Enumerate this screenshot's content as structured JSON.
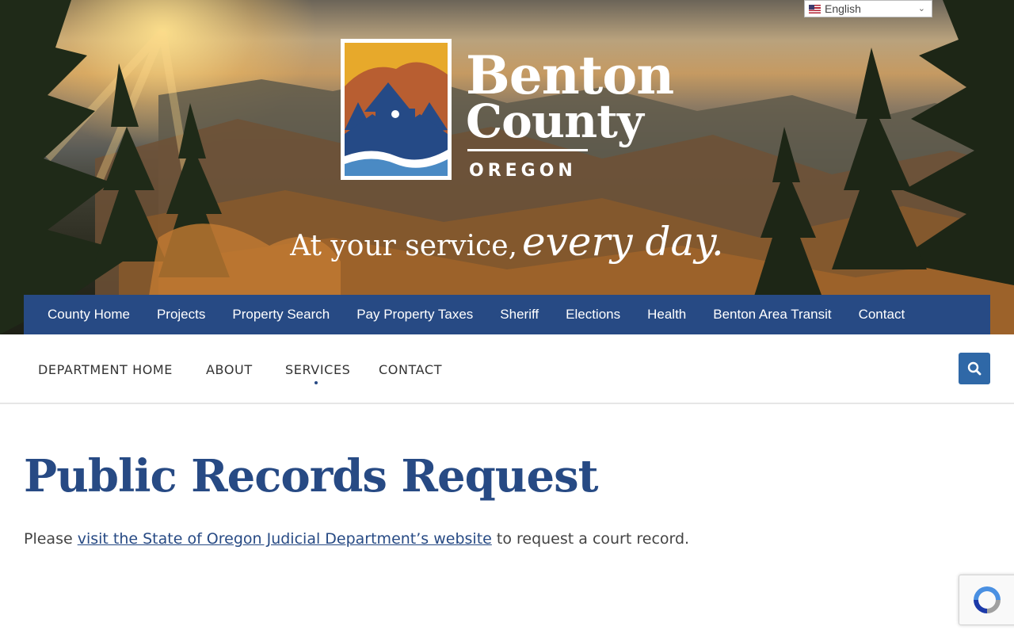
{
  "language_selector": {
    "label": "English"
  },
  "logo": {
    "word1": "Benton",
    "word2": "County",
    "sub": "OREGON"
  },
  "tagline": {
    "part1": "At your service,",
    "part2": "every day."
  },
  "top_nav": {
    "items": [
      "County Home",
      "Projects",
      "Property Search",
      "Pay Property Taxes",
      "Sheriff",
      "Elections",
      "Health",
      "Benton Area Transit",
      "Contact"
    ]
  },
  "sub_nav": {
    "items": [
      "DEPARTMENT HOME",
      "ABOUT",
      "SERVICES",
      "CONTACT"
    ],
    "active": "SERVICES"
  },
  "page": {
    "title": "Public Records Request",
    "text_before": "Please ",
    "link_text": "visit the State of Oregon Judicial Department’s website",
    "text_after": " to request a court record."
  },
  "colors": {
    "brand_blue": "#274a84",
    "search_button": "#2f68a7"
  },
  "icons": {
    "search": "search-icon",
    "recaptcha": "recaptcha-icon",
    "flag": "us-flag-icon"
  }
}
